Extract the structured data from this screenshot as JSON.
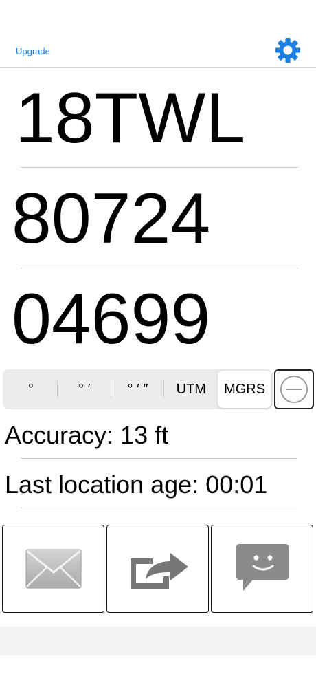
{
  "header": {
    "upgrade_label": "Upgrade",
    "settings_icon": "gear-icon",
    "accent_color": "#1a7fe0"
  },
  "coordinates": {
    "grid_zone": "18TWL",
    "easting": "80724",
    "northing": "04699"
  },
  "format_selector": {
    "options": [
      "°",
      "° ′",
      "° ′ ″",
      "UTM",
      "MGRS"
    ],
    "selected": "MGRS"
  },
  "minus_icon": "minus-circle-icon",
  "info": {
    "accuracy": "Accuracy: 13 ft",
    "last_location_age": "Last location age: 00:01"
  },
  "actions": [
    {
      "name": "email",
      "icon": "envelope-icon"
    },
    {
      "name": "share",
      "icon": "share-arrow-icon"
    },
    {
      "name": "message",
      "icon": "chat-bubble-icon"
    }
  ]
}
